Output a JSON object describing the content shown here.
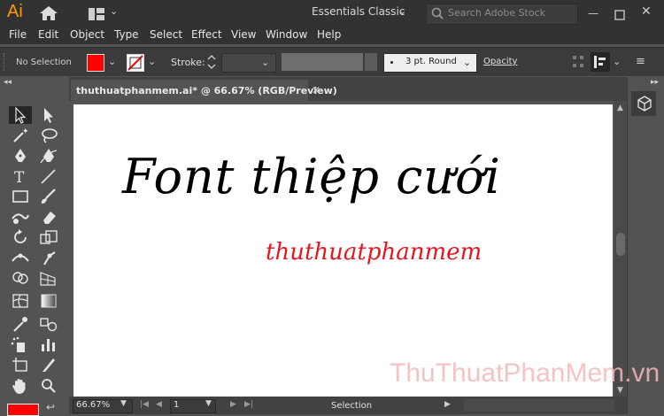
{
  "app": {
    "logo": "Ai",
    "workspace": "Essentials Classic",
    "search_placeholder": "Search Adobe Stock",
    "window_controls": {
      "minimize": "—",
      "close": "✕"
    }
  },
  "menubar": [
    "File",
    "Edit",
    "Object",
    "Type",
    "Select",
    "Effect",
    "View",
    "Window",
    "Help"
  ],
  "control_bar": {
    "selection_status": "No Selection",
    "fill_color": "#ff0000",
    "stroke_label": "Stroke:",
    "brush": "3 pt. Round",
    "opacity_label": "Opacity"
  },
  "document": {
    "tab_title": "thuthuatphanmem.ai* @ 66.67% (RGB/Preview)",
    "artboard_text": {
      "title": "Font thiệp cưới",
      "subtitle": "thuthuatphanmem"
    }
  },
  "status_bar": {
    "zoom": "66.67%",
    "page": "1",
    "active_tool": "Selection"
  },
  "watermark": "ThuThuatPhanMem.vn",
  "tools": [
    "selection-tool",
    "direct-selection-tool",
    "magic-wand-tool",
    "lasso-tool",
    "pen-tool",
    "curvature-tool",
    "type-tool",
    "line-segment-tool",
    "rectangle-tool",
    "paintbrush-tool",
    "shaper-tool",
    "eraser-tool",
    "rotate-tool",
    "scale-tool",
    "width-tool",
    "puppet-warp-tool",
    "shape-builder-tool",
    "perspective-grid-tool",
    "mesh-tool",
    "gradient-tool",
    "eyedropper-tool",
    "blend-tool",
    "symbol-sprayer-tool",
    "column-graph-tool",
    "artboard-tool",
    "slice-tool",
    "hand-tool",
    "zoom-tool"
  ],
  "colors": {
    "accent_logo": "#ff9a00",
    "fill": "#ff0000",
    "subtitle": "#e8141e",
    "watermark": "#f3b9b9"
  }
}
